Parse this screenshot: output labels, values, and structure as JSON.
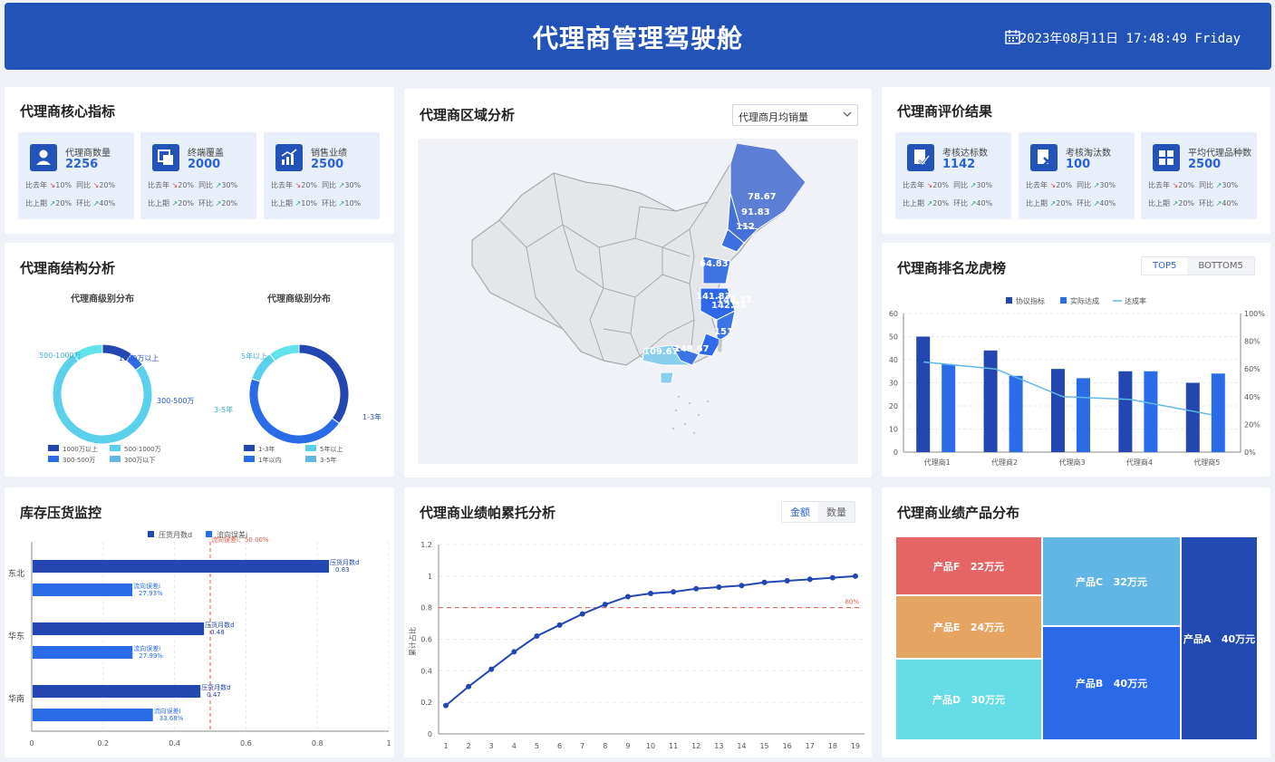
{
  "header": {
    "title": "代理商管理驾驶舱",
    "datetime": "2023年08月11日 17:48:49 Friday"
  },
  "core": {
    "title": "代理商核心指标",
    "cards": [
      {
        "label": "代理商数量",
        "value": "2256",
        "r1": [
          "比去年",
          "10%",
          "同比",
          "20%"
        ],
        "r2": [
          "比上期",
          "20%",
          "环比",
          "40%"
        ]
      },
      {
        "label": "终端覆盖",
        "value": "2000",
        "r1": [
          "比去年",
          "20%",
          "同比",
          "30%"
        ],
        "r2": [
          "比上期",
          "20%",
          "环比",
          "20%"
        ]
      },
      {
        "label": "销售业绩",
        "value": "2500",
        "r1": [
          "比去年",
          "20%",
          "同比",
          "30%"
        ],
        "r2": [
          "比上期",
          "10%",
          "环比",
          "10%"
        ]
      }
    ]
  },
  "evaluation": {
    "title": "代理商评价结果",
    "cards": [
      {
        "label": "考核达标数",
        "value": "1142",
        "r1": [
          "比去年",
          "20%",
          "同比",
          "30%"
        ],
        "r2": [
          "比上期",
          "20%",
          "环比",
          "40%"
        ]
      },
      {
        "label": "考核淘汰数",
        "value": "100",
        "r1": [
          "比去年",
          "20%",
          "同比",
          "30%"
        ],
        "r2": [
          "比上期",
          "20%",
          "环比",
          "40%"
        ]
      },
      {
        "label": "平均代理品种数",
        "value": "2500",
        "r1": [
          "比去年",
          "20%",
          "同比",
          "30%"
        ],
        "r2": [
          "比上期",
          "20%",
          "环比",
          "40%"
        ]
      }
    ]
  },
  "region": {
    "title": "代理商区域分析",
    "select_value": "代理商月均销量",
    "map_labels": [
      "78.67",
      "91.83",
      "112",
      "64.83",
      "141.83",
      "146.33",
      "142.33",
      "151",
      "109.67",
      "148.67"
    ]
  },
  "structure": {
    "title": "代理商结构分析",
    "donut1_title": "代理商级别分布",
    "donut2_title": "代理商级别分布",
    "donut1_labels": [
      "1000万以上",
      "300-500万",
      "300万以下",
      "500-1000万"
    ],
    "donut2_labels": [
      "1-3年",
      "1年以内",
      "3-5年",
      "5年以上"
    ],
    "legend1": [
      "1000万以上",
      "500-1000万",
      "300-500万",
      "300万以下"
    ],
    "legend2": [
      "1-3年",
      "5年以上",
      "1年以内",
      "3-5年"
    ]
  },
  "ranking": {
    "title": "代理商排名龙虎榜",
    "tab_top": "TOP5",
    "tab_bottom": "BOTTOM5",
    "legend": [
      "协议指标",
      "实际达成",
      "达成率"
    ]
  },
  "inventory": {
    "title": "库存压货监控",
    "legend": [
      "压货月数d",
      "流向误差i"
    ],
    "ref_label": "流向误差i：50.00%",
    "bar_a_label": "压货月数d",
    "bar_b_label": "流向误差i"
  },
  "pareto": {
    "title": "代理商业绩帕累托分析",
    "tab_amount": "金额",
    "tab_count": "数量",
    "y_label": "累计占比",
    "ref_label": "80%"
  },
  "products": {
    "title": "代理商业绩产品分布",
    "cells": [
      {
        "name": "产品F",
        "value": "22万元",
        "color": "#e56565"
      },
      {
        "name": "产品E",
        "value": "24万元",
        "color": "#e6a463"
      },
      {
        "name": "产品D",
        "value": "30万元",
        "color": "#66dde6"
      },
      {
        "name": "产品C",
        "value": "32万元",
        "color": "#62b6e6"
      },
      {
        "name": "产品B",
        "value": "40万元",
        "color": "#2a69e8"
      },
      {
        "name": "产品A",
        "value": "40万元",
        "color": "#2349b2"
      }
    ]
  },
  "colors": {
    "primary": "#2353b8",
    "blue": "#2a63d8",
    "light": "#5ad6e6",
    "bg": "#eef1f7"
  },
  "chart_data": [
    {
      "type": "pie",
      "title": "代理商级别分布",
      "categories": [
        "1000万以上",
        "300-500万",
        "300万以下",
        "500-1000万"
      ],
      "values": [
        10,
        5,
        75,
        10
      ]
    },
    {
      "type": "pie",
      "title": "代理商级别分布",
      "categories": [
        "1-3年",
        "1年以内",
        "3-5年",
        "5年以上"
      ],
      "values": [
        35,
        45,
        10,
        10
      ]
    },
    {
      "type": "bar",
      "categories": [
        "代理商1",
        "代理商2",
        "代理商3",
        "代理商4",
        "代理商5"
      ],
      "series": [
        {
          "name": "协议指标",
          "values": [
            50,
            44,
            36,
            35,
            30
          ]
        },
        {
          "name": "实际达成",
          "values": [
            38,
            33,
            32,
            35,
            34
          ]
        },
        {
          "name": "达成率",
          "values": [
            65,
            60,
            40,
            38,
            27
          ]
        }
      ],
      "ylim": [
        0,
        60
      ],
      "y2lim": [
        0,
        100
      ],
      "y_ticks": [
        "0",
        "10",
        "20",
        "30",
        "40",
        "50",
        "60"
      ],
      "y2_ticks": [
        "0%",
        "20%",
        "40%",
        "60%",
        "80%",
        "100%"
      ]
    },
    {
      "type": "bar",
      "orientation": "horizontal",
      "categories": [
        "东北",
        "华东",
        "华南"
      ],
      "series": [
        {
          "name": "压货月数d",
          "values": [
            0.83,
            0.48,
            0.47
          ],
          "labels": [
            "0.83",
            "0.48",
            "0.47"
          ]
        },
        {
          "name": "流向误差i",
          "values": [
            0.2793,
            0.2799,
            0.3368
          ],
          "labels": [
            "27.93%",
            "27.99%",
            "33.68%"
          ]
        }
      ],
      "xlim": [
        0,
        1
      ],
      "x_ticks": [
        "0",
        "0.2",
        "0.4",
        "0.6",
        "0.8",
        "1"
      ],
      "reference": 0.5
    },
    {
      "type": "line",
      "x": [
        1,
        2,
        3,
        4,
        5,
        6,
        7,
        8,
        9,
        10,
        11,
        12,
        13,
        14,
        15,
        16,
        17,
        18,
        19
      ],
      "values": [
        0.18,
        0.3,
        0.41,
        0.52,
        0.62,
        0.69,
        0.76,
        0.82,
        0.87,
        0.89,
        0.9,
        0.92,
        0.93,
        0.94,
        0.96,
        0.97,
        0.98,
        0.99,
        1.0
      ],
      "ylim": [
        0,
        1.2
      ],
      "y_ticks": [
        "0",
        "0.2",
        "0.4",
        "0.6",
        "0.8",
        "1",
        "1.2"
      ],
      "reference": 0.8
    }
  ]
}
